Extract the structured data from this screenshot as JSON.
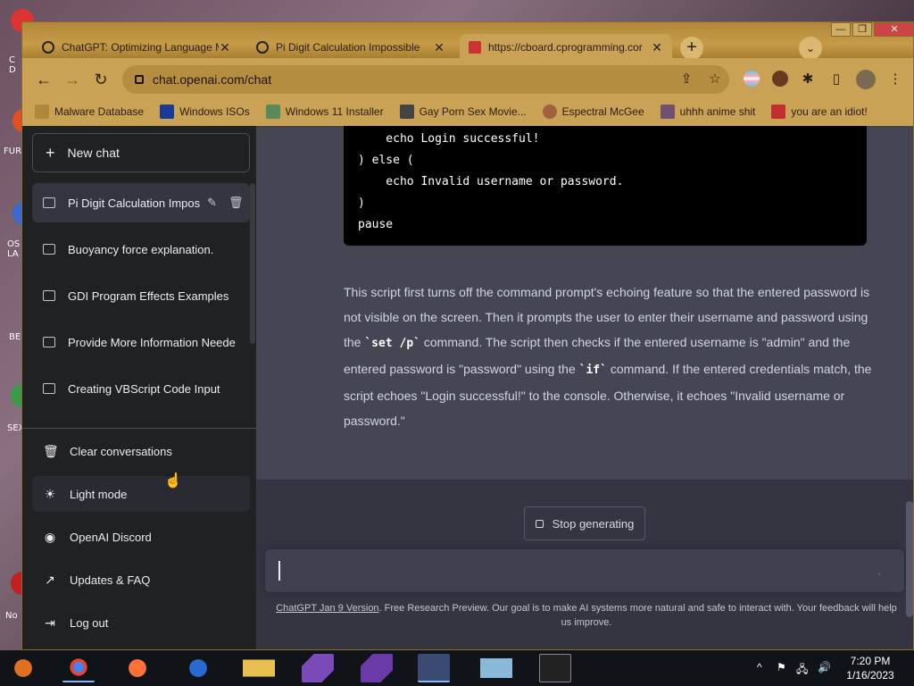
{
  "desktop": {
    "labels": [
      "C D",
      "FUR",
      "OS LA",
      "BE",
      "SEX",
      "No"
    ]
  },
  "window": {
    "controls": {
      "minimize": "—",
      "maximize": "❐",
      "close": "✕"
    }
  },
  "tabs": [
    {
      "title": "ChatGPT: Optimizing Language M",
      "close": "✕",
      "icon": "chatgpt-icon"
    },
    {
      "title": "Pi Digit Calculation Impossible",
      "close": "✕",
      "icon": "chatgpt-icon"
    },
    {
      "title": "https://cboard.cprogramming.cor",
      "close": "✕",
      "icon": "cboard-icon"
    }
  ],
  "tabbar": {
    "new_tab": "+",
    "tab_search": "⌄"
  },
  "toolbar": {
    "back": "←",
    "forward": "→",
    "reload": "↻",
    "url": "chat.openai.com/chat",
    "share": "⇪",
    "star": "☆",
    "extensions": "✱",
    "sidebar": "▯",
    "menu": "⋮"
  },
  "bookmarks": [
    {
      "label": "Malware Database",
      "icon": "malware-icon",
      "color": "#b08838"
    },
    {
      "label": "Windows ISOs",
      "icon": "x-icon",
      "color": "#1a3a9a"
    },
    {
      "label": "Windows 11 Installer",
      "icon": "image-icon",
      "color": "#5a8a5a"
    },
    {
      "label": "Gay Porn Sex Movie...",
      "icon": "favicon-icon",
      "color": "#444"
    },
    {
      "label": "Espectral McGee",
      "icon": "avatar-icon",
      "color": "#a06040"
    },
    {
      "label": "uhhh anime shit",
      "icon": "anime-icon",
      "color": "#705070"
    },
    {
      "label": "you are an idiot!",
      "icon": "flag-icon",
      "color": "#c03030"
    }
  ],
  "sidebar": {
    "new_chat": "New chat",
    "conversations": [
      {
        "title": "Pi Digit Calculation Impos",
        "active": true
      },
      {
        "title": "Buoyancy force explanation.",
        "active": false
      },
      {
        "title": "GDI Program Effects Examples",
        "active": false
      },
      {
        "title": "Provide More Information Neede",
        "active": false
      },
      {
        "title": "Creating VBScript Code Input",
        "active": false
      }
    ],
    "links": [
      {
        "label": "Clear conversations",
        "icon": "trash-icon",
        "glyph": "🗑"
      },
      {
        "label": "Light mode",
        "icon": "sun-icon",
        "glyph": "☀"
      },
      {
        "label": "OpenAI Discord",
        "icon": "discord-icon",
        "glyph": "◉"
      },
      {
        "label": "Updates & FAQ",
        "icon": "external-link-icon",
        "glyph": "↗"
      },
      {
        "label": "Log out",
        "icon": "logout-icon",
        "glyph": "⇥"
      }
    ]
  },
  "chat": {
    "code_lines": [
      "    echo Login successful!",
      ") else (",
      "    echo Invalid username or password.",
      ")",
      "pause"
    ],
    "explanation": [
      "This script first turns off the command prompt's echoing feature so that the entered password is not visible on the screen. Then it prompts the user to enter their username and password using the ",
      "`set /p`",
      " command. The script then checks if the entered username is \"admin\" and the entered password is \"password\" using the ",
      "`if`",
      " command. If the entered credentials match, the script echoes \"Login successful!\" to the console. Otherwise, it echoes \"Invalid username or password.\""
    ],
    "stop_generating": "Stop generating",
    "prompt_value": "",
    "prompt_send": "·",
    "footer_version": "ChatGPT Jan 9 Version",
    "footer_text": ". Free Research Preview. Our goal is to make AI systems more natural and safe to interact with. Your feedback will help us improve."
  },
  "taskbar": {
    "apps": [
      {
        "name": "media-player-icon",
        "color": "#e07020"
      },
      {
        "name": "chrome-icon",
        "color": "#4285f4"
      },
      {
        "name": "firefox-icon",
        "color": "#ff7139"
      },
      {
        "name": "ie-icon",
        "color": "#2a6ad0"
      },
      {
        "name": "file-explorer-icon",
        "color": "#e8c050"
      },
      {
        "name": "visual-studio-installer-icon",
        "color": "#7a4ab8"
      },
      {
        "name": "visual-studio-icon",
        "color": "#6a3aa8"
      },
      {
        "name": "network-app-icon",
        "color": "#5a7ac0"
      },
      {
        "name": "notepad-icon",
        "color": "#8ab8d8"
      },
      {
        "name": "cmd-icon",
        "color": "#222"
      }
    ],
    "tray": {
      "chevron": "^",
      "flag": "⚑",
      "network": "🖧",
      "volume": "🔊"
    },
    "time": "7:20 PM",
    "date": "1/16/2023"
  },
  "colors": {
    "sidebar_bg": "#202123",
    "chat_bg": "#444654",
    "input_bg": "#40414f",
    "browser_frame": "#c9a256"
  }
}
